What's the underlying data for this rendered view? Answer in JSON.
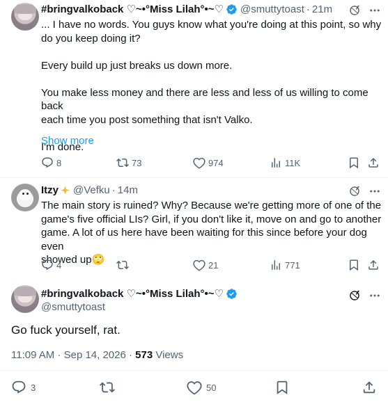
{
  "tweet1": {
    "display_name": "#bringvalkoback ♡~•°Miss Lilah°•~♡",
    "handle": "@smuttytoast",
    "separator": "·",
    "time": "21m",
    "lines": [
      "... I have no words. You guys know what you're doing at this point, so why",
      "do you keep doing it?",
      "",
      "Every build up just breaks us down more.",
      "",
      "You make less money and there are less and less of us willing to come back",
      "each time you post something that isn't Valko.",
      "",
      "I'm done."
    ],
    "show_more": "Show more",
    "replies": "8",
    "reposts": "73",
    "likes": "974",
    "views": "11K"
  },
  "tweet2": {
    "display_name": "Itzy",
    "handle": "@Vefku",
    "separator": "·",
    "time": "14m",
    "lines": [
      "The main story is ruined? Why? Because we're getting more of one of the",
      "game's five official LIs? Girl, if you don't like it, move on and go to another",
      "game. A lot of us here have been waiting for this since before your dog even",
      "showed up🙄"
    ],
    "replies": "4",
    "reposts": "",
    "likes": "21",
    "views": "771"
  },
  "main": {
    "display_name": "#bringvalkoback ♡~•°Miss Lilah°•~♡",
    "handle": "@smuttytoast",
    "text": "Go fuck yourself, rat.",
    "timestamp": "11:09 AM · Sep 14, 2026 · ",
    "view_count": "573",
    "views_label": " Views",
    "replies": "3",
    "likes": "50"
  },
  "icons": {
    "more": "more-dots-icon",
    "grok": "grok-icon",
    "reply": "reply-icon",
    "repost": "repost-icon",
    "like": "heart-icon",
    "views": "views-icon",
    "bookmark": "bookmark-icon",
    "share": "share-icon",
    "verified": "verified-badge-icon"
  },
  "colors": {
    "link": "#1d9bf0",
    "secondary_text": "#536471",
    "primary_text": "#0f1419",
    "verified": "#1d9bf0"
  }
}
